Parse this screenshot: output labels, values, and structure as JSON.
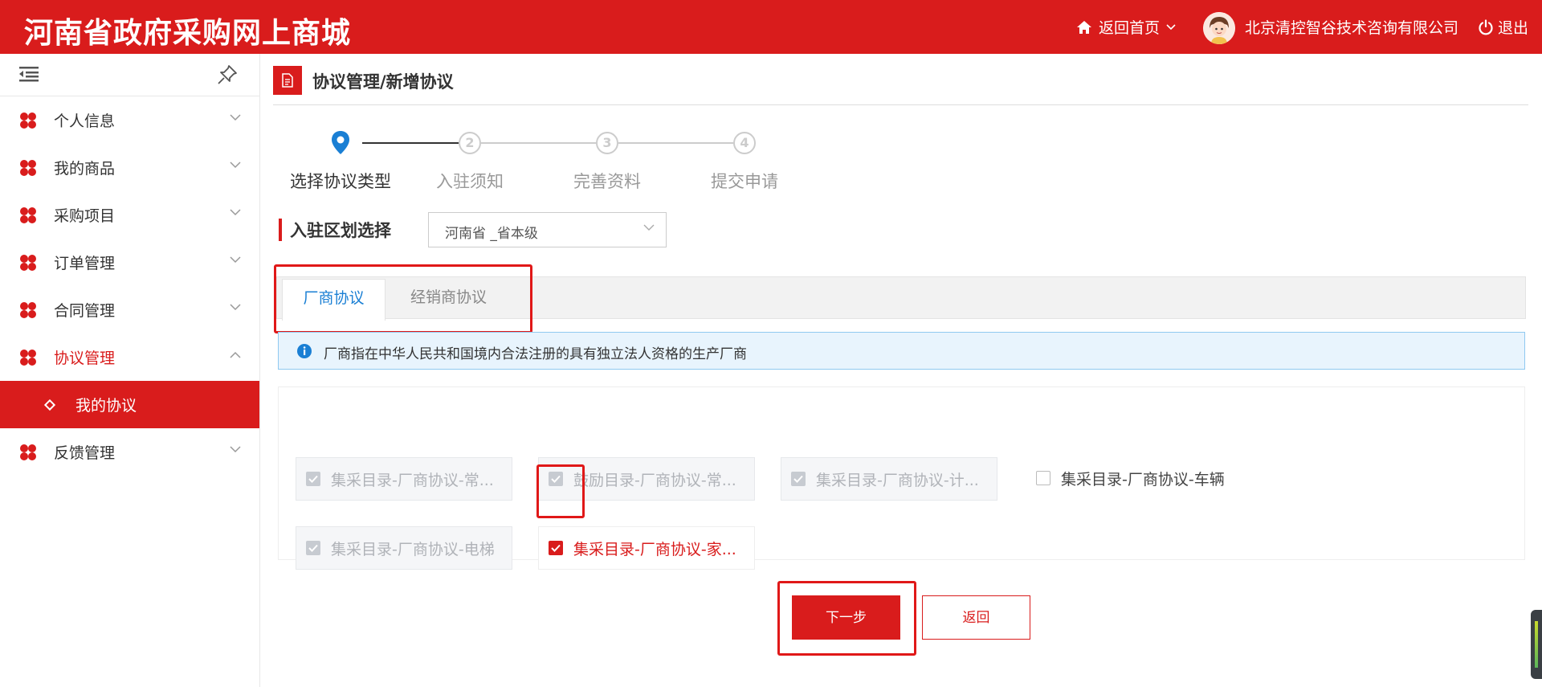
{
  "header": {
    "logo": "河南省政府采购网上商城",
    "home_label": "返回首页",
    "company": "北京清控智谷技术咨询有限公司",
    "logout_label": "退出"
  },
  "sidebar": {
    "items": [
      {
        "label": "个人信息",
        "expanded": false
      },
      {
        "label": "我的商品",
        "expanded": false
      },
      {
        "label": "采购项目",
        "expanded": false
      },
      {
        "label": "订单管理",
        "expanded": false
      },
      {
        "label": "合同管理",
        "expanded": false
      },
      {
        "label": "协议管理",
        "expanded": true,
        "active": true
      },
      {
        "label": "反馈管理",
        "expanded": false
      }
    ],
    "sub_item": "我的协议"
  },
  "page": {
    "title": "协议管理/新增协议"
  },
  "steps": [
    {
      "label": "选择协议类型",
      "state": "current"
    },
    {
      "number": "2",
      "label": "入驻须知",
      "state": "pending"
    },
    {
      "number": "3",
      "label": "完善资料",
      "state": "pending"
    },
    {
      "number": "4",
      "label": "提交申请",
      "state": "pending"
    }
  ],
  "region": {
    "label": "入驻区划选择",
    "value": "河南省 _省本级"
  },
  "tabs": [
    {
      "label": "厂商协议",
      "active": true
    },
    {
      "label": "经销商协议",
      "active": false
    }
  ],
  "info": {
    "text": "厂商指在中华人民共和国境内合法注册的具有独立法人资格的生产厂商"
  },
  "options": [
    {
      "label": "集采目录-厂商协议-常...",
      "state": "disabled"
    },
    {
      "label": "鼓励目录-厂商协议-常...",
      "state": "disabled"
    },
    {
      "label": "集采目录-厂商协议-计...",
      "state": "disabled"
    },
    {
      "label": "集采目录-厂商协议-车辆",
      "state": "unchecked"
    },
    {
      "label": "集采目录-厂商协议-电梯",
      "state": "disabled"
    },
    {
      "label": "集采目录-厂商协议-家...",
      "state": "checked"
    }
  ],
  "buttons": {
    "next": "下一步",
    "back": "返回"
  },
  "colors": {
    "brand": "#d91c1c",
    "tab_active": "#1a7fd4",
    "info_bg": "#e8f4fd"
  }
}
